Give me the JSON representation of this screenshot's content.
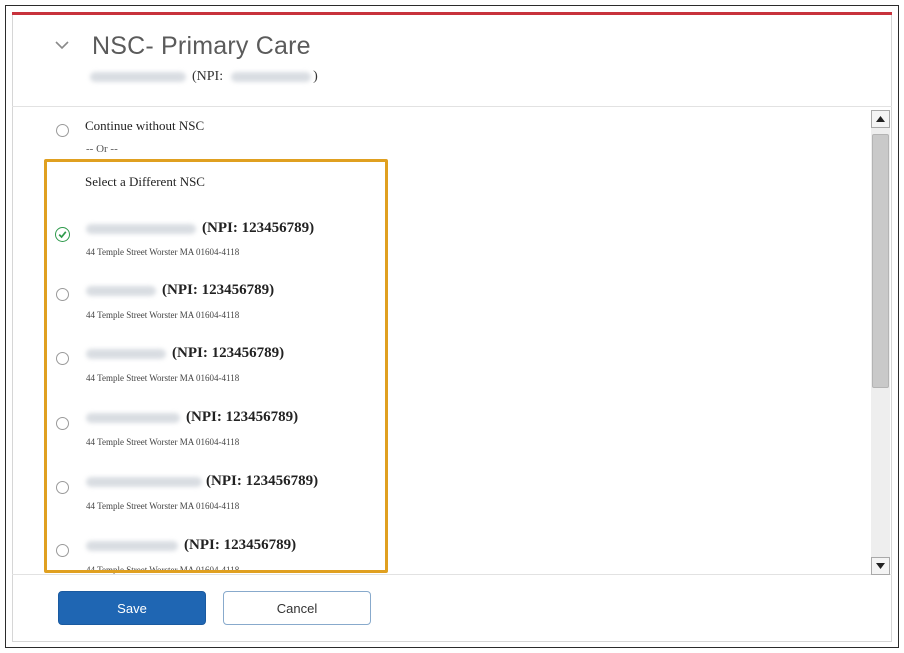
{
  "header": {
    "title": "NSC- Primary Care",
    "subtitle_npi_prefix": "(NPI:",
    "subtitle_npi_suffix": ")"
  },
  "options": {
    "continue_label": "Continue without NSC",
    "or_label": "-- Or --",
    "select_different_label": "Select a Different NSC"
  },
  "providers": [
    {
      "npi_text": "(NPI: 123456789)",
      "address": "44 Temple Street Worster MA 01604-4118",
      "selected": true
    },
    {
      "npi_text": "(NPI: 123456789)",
      "address": "44 Temple Street Worster MA 01604-4118",
      "selected": false
    },
    {
      "npi_text": "(NPI: 123456789)",
      "address": "44 Temple Street Worster MA 01604-4118",
      "selected": false
    },
    {
      "npi_text": "(NPI: 123456789)",
      "address": "44 Temple Street Worster MA 01604-4118",
      "selected": false
    },
    {
      "npi_text": "(NPI: 123456789)",
      "address": "44 Temple Street Worster MA 01604-4118",
      "selected": false
    },
    {
      "npi_text": "(NPI: 123456789)",
      "address": "44 Temple Street Worster MA 01604-4118",
      "selected": false
    }
  ],
  "footer": {
    "save_label": "Save",
    "cancel_label": "Cancel"
  },
  "colors": {
    "accent_red": "#c8323c",
    "primary_blue": "#1f66b3",
    "highlight_orange": "#e0a020",
    "selected_green": "#2e9a4b"
  },
  "icons": {
    "collapse": "chevron-down-icon",
    "selected": "check-circle-icon",
    "scroll_up": "arrow-up-icon",
    "scroll_down": "arrow-down-icon"
  }
}
